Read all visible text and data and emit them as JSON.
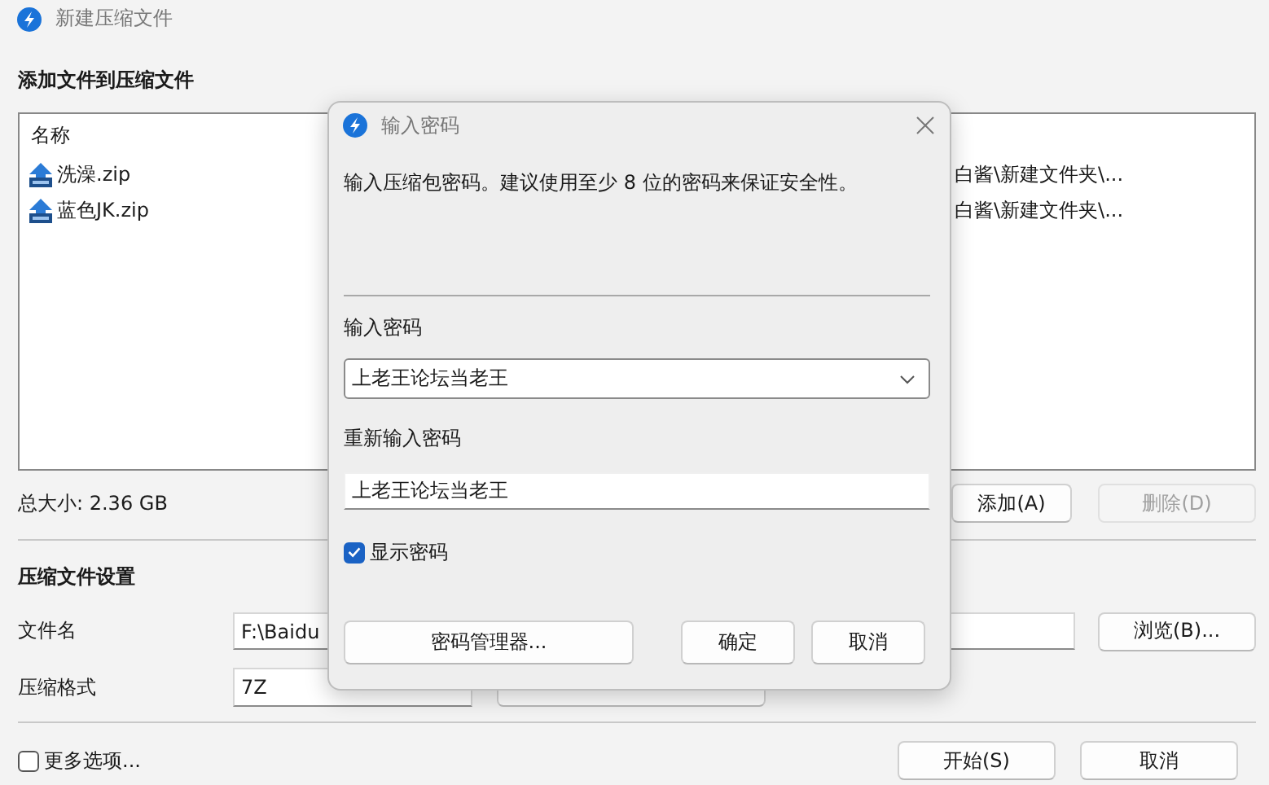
{
  "window": {
    "title": "新建压缩文件"
  },
  "add_section": {
    "heading": "添加文件到压缩文件",
    "list": {
      "columns": [
        "名称"
      ],
      "rows": [
        {
          "name": "洗澡.zip",
          "column_2": "白酱\\新建文件夹\\..."
        },
        {
          "name": "蓝色JK.zip",
          "column_2": "白酱\\新建文件夹\\..."
        }
      ]
    },
    "total_size": "总大小: 2.36 GB",
    "buttons": [
      {
        "label": "添加(A)",
        "disabled": false
      },
      {
        "label": "删除(D)",
        "disabled": true
      }
    ]
  },
  "settings": {
    "heading": "压缩文件设置",
    "filename": {
      "label": "文件名",
      "value": "F:\\Baidu"
    },
    "browse_button": "浏览(B)...",
    "format": {
      "label": "压缩格式",
      "value": "7Z"
    }
  },
  "more_options": {
    "label": "更多选项...",
    "checked": false
  },
  "footer_buttons": [
    "开始(S)",
    "取消"
  ],
  "dialog": {
    "title": "输入密码",
    "message": "输入压缩包密码。建议使用至少 8 位的密码来保证安全性。",
    "password": {
      "label": "输入密码",
      "value": "上老王论坛当老王"
    },
    "confirm": {
      "label": "重新输入密码",
      "value": "上老王论坛当老王"
    },
    "show_password": {
      "label": "显示密码",
      "checked": true
    },
    "buttons": [
      {
        "label": "密码管理器...",
        "kind": "wide"
      },
      {
        "label": "确定",
        "kind": "normal"
      },
      {
        "label": "取消",
        "kind": "normal"
      }
    ]
  }
}
